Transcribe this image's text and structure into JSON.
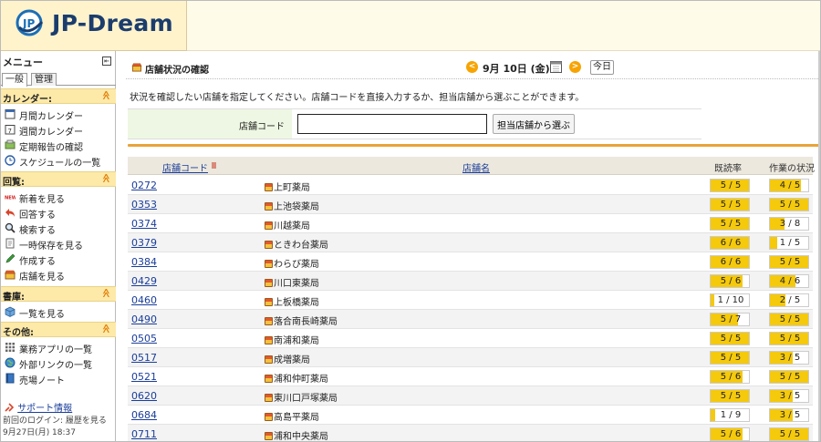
{
  "app": {
    "brand": "JP-Dream",
    "badge": "JP"
  },
  "sidebar": {
    "menu_title": "メニュー",
    "collapse_label": "⇤",
    "tabs": [
      "一般",
      "管理"
    ],
    "sections": [
      {
        "label": "カレンダー:",
        "items": [
          {
            "label": "月間カレンダー",
            "icon": "calendar-month-icon"
          },
          {
            "label": "週間カレンダー",
            "icon": "calendar-week-icon"
          },
          {
            "label": "定期報告の確認",
            "icon": "report-icon"
          },
          {
            "label": "スケジュールの一覧",
            "icon": "clock-icon"
          }
        ]
      },
      {
        "label": "回覧:",
        "items": [
          {
            "label": "新着を見る",
            "icon": "new-icon"
          },
          {
            "label": "回答する",
            "icon": "reply-icon"
          },
          {
            "label": "検索する",
            "icon": "search-icon"
          },
          {
            "label": "一時保存を見る",
            "icon": "draft-icon"
          },
          {
            "label": "作成する",
            "icon": "pencil-icon"
          },
          {
            "label": "店舗を見る",
            "icon": "shop-icon"
          }
        ]
      },
      {
        "label": "書庫:",
        "items": [
          {
            "label": "一覧を見る",
            "icon": "box-icon"
          }
        ]
      },
      {
        "label": "その他:",
        "items": [
          {
            "label": "業務アプリの一覧",
            "icon": "apps-icon"
          },
          {
            "label": "外部リンクの一覧",
            "icon": "globe-icon"
          },
          {
            "label": "売場ノート",
            "icon": "note-icon"
          }
        ]
      }
    ],
    "section_arrow": "≫",
    "support_link": "サポート情報",
    "last_login_label": "前回のログイン: 履歴を見る",
    "last_login_time": "9月27日(月) 18:37"
  },
  "main": {
    "title": "店舗状況の確認",
    "date": "9月 10日 (金)",
    "prev_label": "<",
    "next_label": ">",
    "today_label": "今日",
    "instructions": "状況を確認したい店舗を指定してください。店舗コードを直接入力するか、担当店舗から選ぶことができます。",
    "form": {
      "code_label": "店舗コード",
      "code_value": "",
      "pick_button": "担当店舗から選ぶ"
    },
    "table": {
      "headers": {
        "code": "店舗コード",
        "name": "店舗名",
        "rate": "既読率",
        "status": "作業の状況"
      },
      "rows": [
        {
          "code": "0272",
          "name": "上町薬局",
          "rate": "5 / 5",
          "rate_pct": 100,
          "status": "4 / 5",
          "status_pct": 80
        },
        {
          "code": "0353",
          "name": "上池袋薬局",
          "rate": "5 / 5",
          "rate_pct": 100,
          "status": "5 / 5",
          "status_pct": 100
        },
        {
          "code": "0374",
          "name": "川越薬局",
          "rate": "5 / 5",
          "rate_pct": 100,
          "status": "3 / 8",
          "status_pct": 37.5
        },
        {
          "code": "0379",
          "name": "ときわ台薬局",
          "rate": "6 / 6",
          "rate_pct": 100,
          "status": "1 / 5",
          "status_pct": 20
        },
        {
          "code": "0384",
          "name": "わらび薬局",
          "rate": "6 / 6",
          "rate_pct": 100,
          "status": "5 / 5",
          "status_pct": 100
        },
        {
          "code": "0429",
          "name": "川口東薬局",
          "rate": "5 / 6",
          "rate_pct": 83.3,
          "status": "4 / 6",
          "status_pct": 66.7
        },
        {
          "code": "0460",
          "name": "上板橋薬局",
          "rate": "1 / 10",
          "rate_pct": 10,
          "status": "2 / 5",
          "status_pct": 40
        },
        {
          "code": "0490",
          "name": "落合南長崎薬局",
          "rate": "5 / 7",
          "rate_pct": 71.4,
          "status": "5 / 5",
          "status_pct": 100
        },
        {
          "code": "0505",
          "name": "南浦和薬局",
          "rate": "5 / 5",
          "rate_pct": 100,
          "status": "5 / 5",
          "status_pct": 100
        },
        {
          "code": "0517",
          "name": "成増薬局",
          "rate": "5 / 5",
          "rate_pct": 100,
          "status": "3 / 5",
          "status_pct": 60
        },
        {
          "code": "0521",
          "name": "浦和仲町薬局",
          "rate": "5 / 6",
          "rate_pct": 83.3,
          "status": "5 / 5",
          "status_pct": 100
        },
        {
          "code": "0620",
          "name": "東川口戸塚薬局",
          "rate": "5 / 5",
          "rate_pct": 100,
          "status": "3 / 5",
          "status_pct": 60
        },
        {
          "code": "0684",
          "name": "高島平薬局",
          "rate": "1 / 9",
          "rate_pct": 11.1,
          "status": "3 / 5",
          "status_pct": 60
        },
        {
          "code": "0711",
          "name": "浦和中央薬局",
          "rate": "5 / 6",
          "rate_pct": 83.3,
          "status": "5 / 5",
          "status_pct": 100
        }
      ]
    }
  },
  "colors": {
    "brand_navy": "#1b3d6d",
    "progress_fill": "#f5c90c",
    "accent_orange": "#f7a400",
    "section_bg": "#fde9a8"
  }
}
